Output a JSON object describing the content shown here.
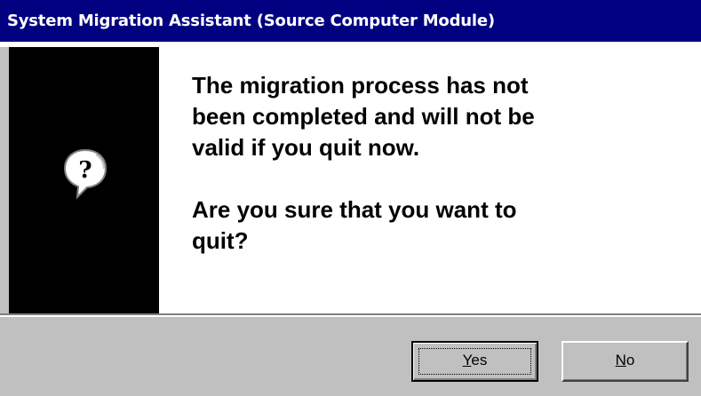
{
  "window": {
    "title": "System Migration Assistant (Source Computer Module)"
  },
  "icon": {
    "name": "question-icon",
    "glyph": "?"
  },
  "message": {
    "line1": "The migration process has not\nbeen completed and will not be\nvalid if you quit now.",
    "line2": " Are you sure that you want to\nquit?"
  },
  "buttons": {
    "yes": {
      "mnemonic": "Y",
      "rest": "es"
    },
    "no": {
      "mnemonic": "N",
      "rest": "o"
    }
  },
  "colors": {
    "titlebar": "#000080",
    "dialog_face": "#c0c0c0",
    "icon_panel": "#000000",
    "message_panel": "#ffffff"
  }
}
